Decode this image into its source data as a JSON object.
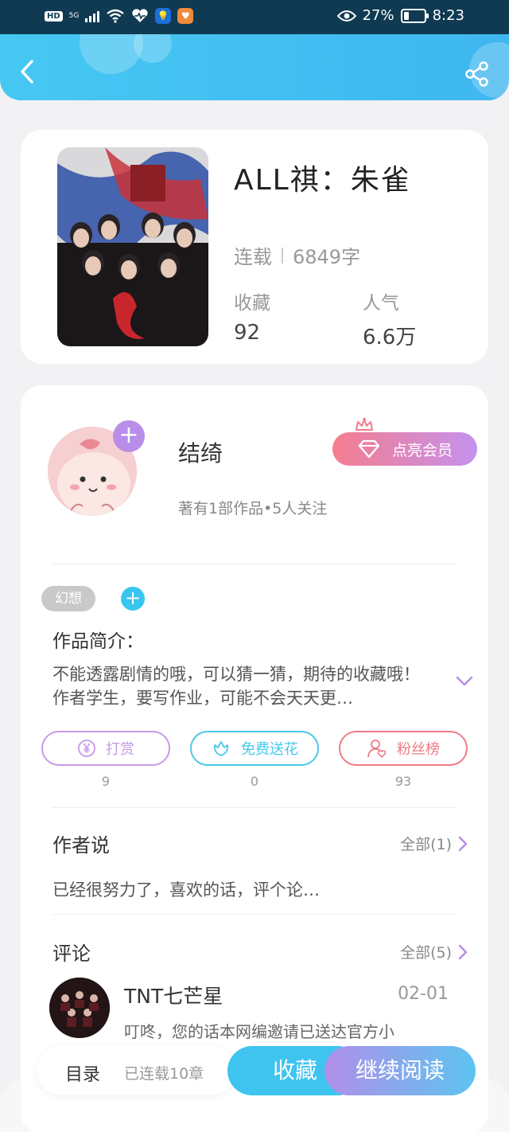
{
  "status_bar": {
    "hd": "HD",
    "network": "5G",
    "battery_percent": "27%",
    "battery_level": 0.27,
    "time": "8:23",
    "icons": [
      "signal-icon",
      "wifi-icon",
      "heart-rate-icon",
      "bulb-app-icon",
      "orange-app-icon",
      "eye-icon",
      "battery-icon"
    ]
  },
  "header": {
    "back_icon": "chevron-left-icon",
    "share_icon": "share-icon",
    "background_color": "#46c8f2"
  },
  "book": {
    "title": "ALL祺：朱雀",
    "status": "连载",
    "word_count": "6849字",
    "favorites_label": "收藏",
    "favorites_value": "92",
    "popularity_label": "人气",
    "popularity_value": "6.6万"
  },
  "author": {
    "name": "结绮",
    "meta": "著有1部作品•5人关注",
    "follow_label": "+",
    "vip_label": "点亮会员"
  },
  "work": {
    "tag": "幻想",
    "add_tag_label": "+",
    "intro_title": "作品简介：",
    "intro_text": "不能透露剧情的哦，可以猜一猜，期待的收藏哦！作者学生，要写作业，可能不会天天更…"
  },
  "actions": [
    {
      "label": "打赏",
      "count": "9",
      "icon": "yuan-coin-icon",
      "color": "#c49ae8"
    },
    {
      "label": "免费送花",
      "count": "0",
      "icon": "flower-icon",
      "color": "#48c8ea"
    },
    {
      "label": "粉丝榜",
      "count": "93",
      "icon": "fan-user-icon",
      "color": "#ee7b86"
    }
  ],
  "author_says": {
    "title": "作者说",
    "more": "全部(1)",
    "text": "已经很努力了，喜欢的话，评个论…"
  },
  "comments": {
    "title": "评论",
    "more": "全部(5)",
    "items": [
      {
        "name": "TNT七芒星",
        "date": "02-01",
        "text": "叮咚，您的话本网编邀请已送达官方小"
      }
    ]
  },
  "bottom": {
    "toc": "目录",
    "serial_info": "已连载10章",
    "favorite": "收藏",
    "continue": "继续阅读"
  }
}
